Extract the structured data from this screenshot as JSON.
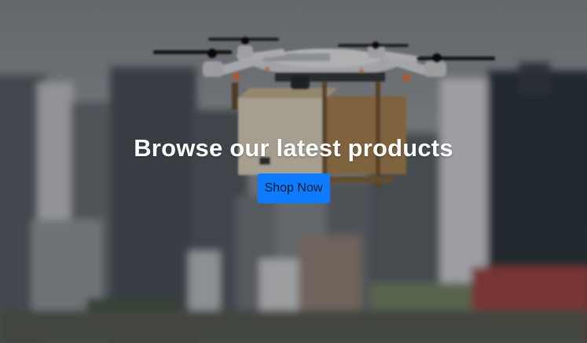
{
  "hero": {
    "image": "drone-delivery-city",
    "title": "Browse our latest products",
    "button_label": "Shop Now"
  },
  "colors": {
    "button_bg": "#0d7bff",
    "button_text": "#0b1a2e",
    "title_text": "#ffffff",
    "overlay": "rgba(0,0,0,0.28)"
  }
}
